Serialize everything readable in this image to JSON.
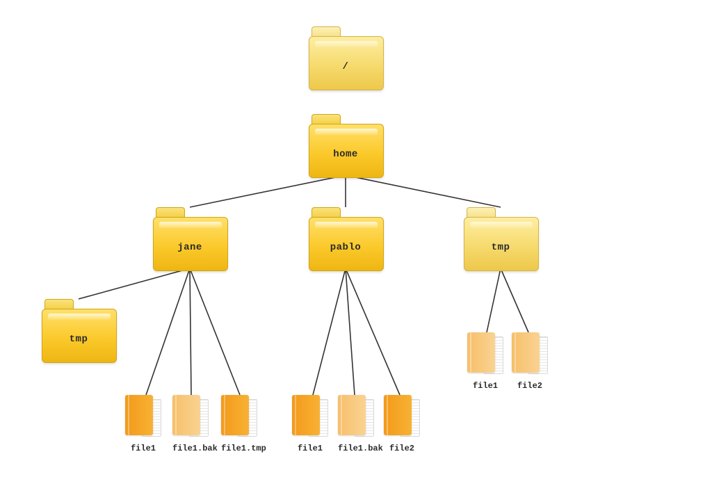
{
  "tree": {
    "root": {
      "label": "/",
      "style": "light"
    },
    "home": {
      "label": "home",
      "style": "dark"
    },
    "jane": {
      "label": "jane",
      "style": "dark"
    },
    "pablo": {
      "label": "pablo",
      "style": "dark"
    },
    "home_tmp": {
      "label": "tmp",
      "style": "light"
    },
    "jane_tmp": {
      "label": "tmp",
      "style": "dark"
    },
    "jane_files": [
      {
        "label": "file1",
        "style": "dark"
      },
      {
        "label": "file1.bak",
        "style": "light"
      },
      {
        "label": "file1.tmp",
        "style": "dark"
      }
    ],
    "pablo_files": [
      {
        "label": "file1",
        "style": "dark"
      },
      {
        "label": "file1.bak",
        "style": "light"
      },
      {
        "label": "file2",
        "style": "dark"
      }
    ],
    "tmp_files": [
      {
        "label": "file1",
        "style": "light"
      },
      {
        "label": "file2",
        "style": "light"
      }
    ]
  }
}
